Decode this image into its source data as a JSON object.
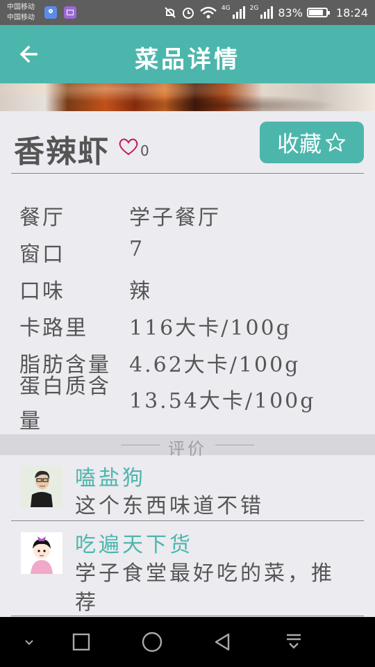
{
  "status_bar": {
    "carrier_1": "中国移动",
    "carrier_2": "中国移动",
    "net_4g": "4G",
    "net_2g": "2G",
    "battery": "83%",
    "time": "18:24"
  },
  "app_bar": {
    "title": "菜品详情",
    "back_icon": "arrow-left-icon"
  },
  "dish": {
    "name": "香辣虾",
    "likes": "0",
    "like_icon": "heart-outline-icon",
    "collect_label": "收藏",
    "collect_icon": "star-outline-icon"
  },
  "info": [
    {
      "label": "餐厅",
      "value": "学子餐厅"
    },
    {
      "label": "窗口",
      "value": "7"
    },
    {
      "label": "口味",
      "value": "辣"
    },
    {
      "label": "卡路里",
      "value": "116大卡/100g"
    },
    {
      "label": "脂肪含量",
      "value": "4.62大卡/100g"
    },
    {
      "label": "蛋白质含",
      "label_line2": "量",
      "value": "13.54大卡/100g"
    }
  ],
  "reviews_header": "评价",
  "reviews": [
    {
      "user": "嗑盐狗",
      "text": "这个东西味道不错"
    },
    {
      "user": "吃遍天下货",
      "text_line1": "学子食堂最好吃的菜，推",
      "text_line2": "荐"
    }
  ],
  "nav_bar": {
    "icons": [
      "chevron-down-icon",
      "recent-apps-icon",
      "home-icon",
      "back-icon",
      "notification-pull-icon"
    ]
  },
  "colors": {
    "accent": "#4db6ac",
    "background": "#ebebf0"
  }
}
